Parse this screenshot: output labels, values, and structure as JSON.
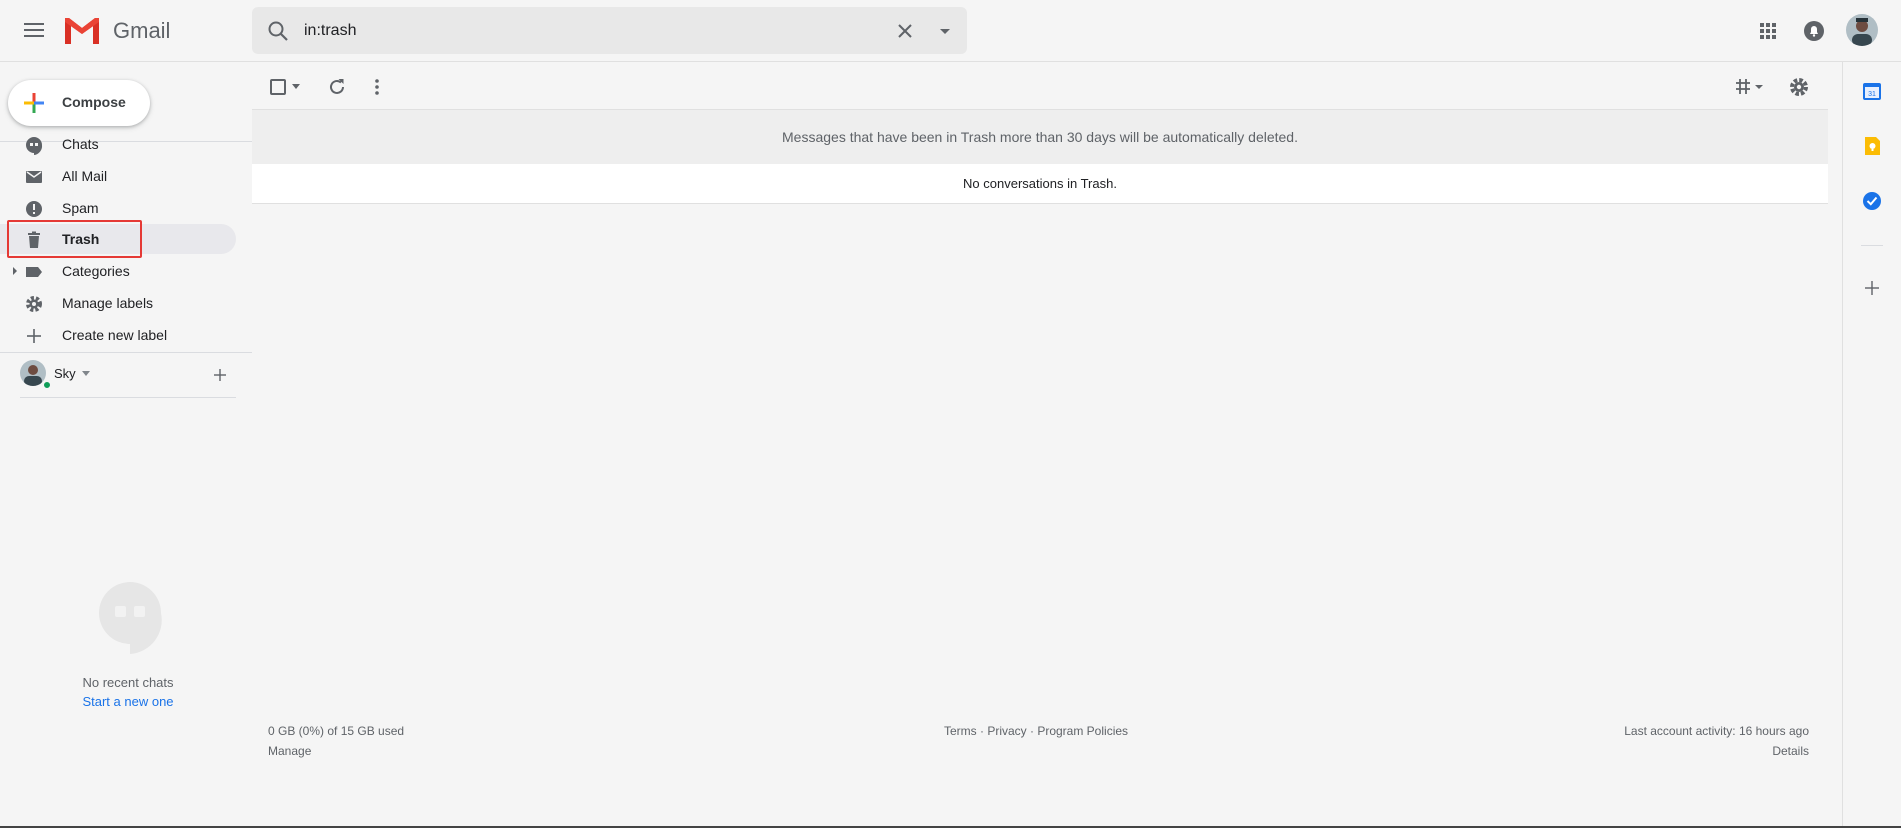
{
  "header": {
    "app_name": "Gmail",
    "search_value": "in:trash",
    "icons": [
      "main-menu-icon",
      "gmail-logo",
      "search-icon",
      "clear-search-icon",
      "search-options-icon",
      "apps-icon",
      "notifications-icon",
      "account-avatar"
    ]
  },
  "sidebar": {
    "compose_label": "Compose",
    "items": [
      {
        "label": "Chats",
        "icon": "chats-icon"
      },
      {
        "label": "All Mail",
        "icon": "mail-icon"
      },
      {
        "label": "Spam",
        "icon": "spam-icon"
      },
      {
        "label": "Trash",
        "icon": "trash-icon",
        "active": true
      },
      {
        "label": "Categories",
        "icon": "label-icon"
      },
      {
        "label": "Manage labels",
        "icon": "gear-icon"
      },
      {
        "label": "Create new label",
        "icon": "plus-icon"
      }
    ],
    "hangouts": {
      "user_name": "Sky",
      "no_chats_text": "No recent chats",
      "start_chat_text": "Start a new one"
    }
  },
  "main": {
    "trash_notice": "Messages that have been in Trash more than 30 days will be automatically deleted.",
    "empty_message": "No conversations in Trash.",
    "footer": {
      "storage": "0 GB (0%) of 15 GB used",
      "manage": "Manage",
      "links": "Terms · Privacy · Program Policies",
      "activity": "Last account activity: 16 hours ago",
      "details": "Details"
    }
  },
  "colors": {
    "accent_red": "#e53935",
    "link_blue": "#1a73e8",
    "online_green": "#0f9d58"
  }
}
